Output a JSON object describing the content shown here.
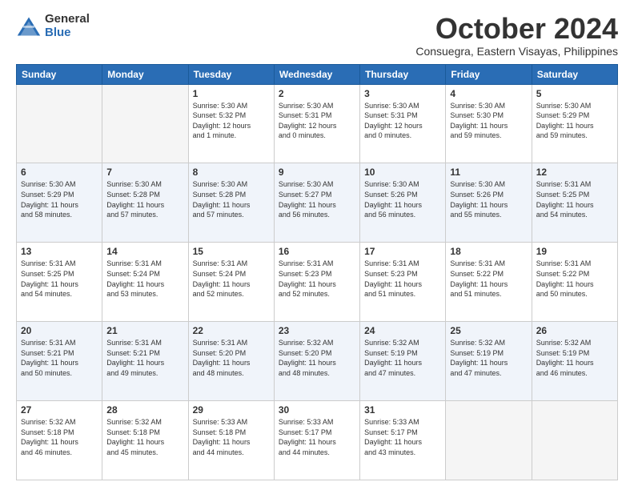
{
  "logo": {
    "general": "General",
    "blue": "Blue"
  },
  "header": {
    "month": "October 2024",
    "location": "Consuegra, Eastern Visayas, Philippines"
  },
  "weekdays": [
    "Sunday",
    "Monday",
    "Tuesday",
    "Wednesday",
    "Thursday",
    "Friday",
    "Saturday"
  ],
  "weeks": [
    [
      {
        "day": "",
        "info": ""
      },
      {
        "day": "",
        "info": ""
      },
      {
        "day": "1",
        "info": "Sunrise: 5:30 AM\nSunset: 5:32 PM\nDaylight: 12 hours\nand 1 minute."
      },
      {
        "day": "2",
        "info": "Sunrise: 5:30 AM\nSunset: 5:31 PM\nDaylight: 12 hours\nand 0 minutes."
      },
      {
        "day": "3",
        "info": "Sunrise: 5:30 AM\nSunset: 5:31 PM\nDaylight: 12 hours\nand 0 minutes."
      },
      {
        "day": "4",
        "info": "Sunrise: 5:30 AM\nSunset: 5:30 PM\nDaylight: 11 hours\nand 59 minutes."
      },
      {
        "day": "5",
        "info": "Sunrise: 5:30 AM\nSunset: 5:29 PM\nDaylight: 11 hours\nand 59 minutes."
      }
    ],
    [
      {
        "day": "6",
        "info": "Sunrise: 5:30 AM\nSunset: 5:29 PM\nDaylight: 11 hours\nand 58 minutes."
      },
      {
        "day": "7",
        "info": "Sunrise: 5:30 AM\nSunset: 5:28 PM\nDaylight: 11 hours\nand 57 minutes."
      },
      {
        "day": "8",
        "info": "Sunrise: 5:30 AM\nSunset: 5:28 PM\nDaylight: 11 hours\nand 57 minutes."
      },
      {
        "day": "9",
        "info": "Sunrise: 5:30 AM\nSunset: 5:27 PM\nDaylight: 11 hours\nand 56 minutes."
      },
      {
        "day": "10",
        "info": "Sunrise: 5:30 AM\nSunset: 5:26 PM\nDaylight: 11 hours\nand 56 minutes."
      },
      {
        "day": "11",
        "info": "Sunrise: 5:30 AM\nSunset: 5:26 PM\nDaylight: 11 hours\nand 55 minutes."
      },
      {
        "day": "12",
        "info": "Sunrise: 5:31 AM\nSunset: 5:25 PM\nDaylight: 11 hours\nand 54 minutes."
      }
    ],
    [
      {
        "day": "13",
        "info": "Sunrise: 5:31 AM\nSunset: 5:25 PM\nDaylight: 11 hours\nand 54 minutes."
      },
      {
        "day": "14",
        "info": "Sunrise: 5:31 AM\nSunset: 5:24 PM\nDaylight: 11 hours\nand 53 minutes."
      },
      {
        "day": "15",
        "info": "Sunrise: 5:31 AM\nSunset: 5:24 PM\nDaylight: 11 hours\nand 52 minutes."
      },
      {
        "day": "16",
        "info": "Sunrise: 5:31 AM\nSunset: 5:23 PM\nDaylight: 11 hours\nand 52 minutes."
      },
      {
        "day": "17",
        "info": "Sunrise: 5:31 AM\nSunset: 5:23 PM\nDaylight: 11 hours\nand 51 minutes."
      },
      {
        "day": "18",
        "info": "Sunrise: 5:31 AM\nSunset: 5:22 PM\nDaylight: 11 hours\nand 51 minutes."
      },
      {
        "day": "19",
        "info": "Sunrise: 5:31 AM\nSunset: 5:22 PM\nDaylight: 11 hours\nand 50 minutes."
      }
    ],
    [
      {
        "day": "20",
        "info": "Sunrise: 5:31 AM\nSunset: 5:21 PM\nDaylight: 11 hours\nand 50 minutes."
      },
      {
        "day": "21",
        "info": "Sunrise: 5:31 AM\nSunset: 5:21 PM\nDaylight: 11 hours\nand 49 minutes."
      },
      {
        "day": "22",
        "info": "Sunrise: 5:31 AM\nSunset: 5:20 PM\nDaylight: 11 hours\nand 48 minutes."
      },
      {
        "day": "23",
        "info": "Sunrise: 5:32 AM\nSunset: 5:20 PM\nDaylight: 11 hours\nand 48 minutes."
      },
      {
        "day": "24",
        "info": "Sunrise: 5:32 AM\nSunset: 5:19 PM\nDaylight: 11 hours\nand 47 minutes."
      },
      {
        "day": "25",
        "info": "Sunrise: 5:32 AM\nSunset: 5:19 PM\nDaylight: 11 hours\nand 47 minutes."
      },
      {
        "day": "26",
        "info": "Sunrise: 5:32 AM\nSunset: 5:19 PM\nDaylight: 11 hours\nand 46 minutes."
      }
    ],
    [
      {
        "day": "27",
        "info": "Sunrise: 5:32 AM\nSunset: 5:18 PM\nDaylight: 11 hours\nand 46 minutes."
      },
      {
        "day": "28",
        "info": "Sunrise: 5:32 AM\nSunset: 5:18 PM\nDaylight: 11 hours\nand 45 minutes."
      },
      {
        "day": "29",
        "info": "Sunrise: 5:33 AM\nSunset: 5:18 PM\nDaylight: 11 hours\nand 44 minutes."
      },
      {
        "day": "30",
        "info": "Sunrise: 5:33 AM\nSunset: 5:17 PM\nDaylight: 11 hours\nand 44 minutes."
      },
      {
        "day": "31",
        "info": "Sunrise: 5:33 AM\nSunset: 5:17 PM\nDaylight: 11 hours\nand 43 minutes."
      },
      {
        "day": "",
        "info": ""
      },
      {
        "day": "",
        "info": ""
      }
    ]
  ]
}
